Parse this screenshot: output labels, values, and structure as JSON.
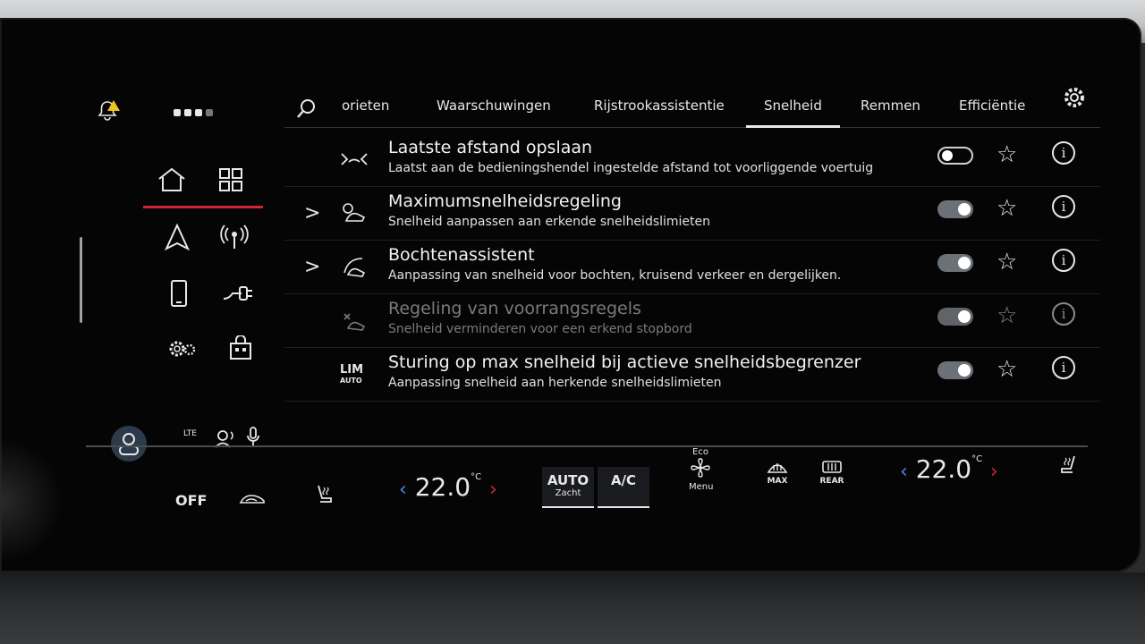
{
  "tabs": [
    "orieten",
    "Waarschuwingen",
    "Rijstrookassistentie",
    "Snelheid",
    "Remmen",
    "Efficiëntie"
  ],
  "active_tab": "Snelheid",
  "rows": [
    {
      "title": "Laatste afstand opslaan",
      "sub": "Laatst aan de bedieningshendel ingestelde afstand tot voorliggende voertuig",
      "toggle": "off",
      "chevron": "",
      "enabled": true
    },
    {
      "title": "Maximumsnelheidsregeling",
      "sub": "Snelheid aanpassen aan erkende snelheidslimieten",
      "toggle": "on",
      "chevron": ">",
      "enabled": true
    },
    {
      "title": "Bochtenassistent",
      "sub": "Aanpassing van snelheid voor bochten, kruisend verkeer en dergelijken.",
      "toggle": "on",
      "chevron": ">",
      "enabled": true
    },
    {
      "title": "Regeling van voorrangsregels",
      "sub": "Snelheid verminderen voor een erkend stopbord",
      "toggle": "on",
      "chevron": "",
      "enabled": false
    },
    {
      "title": "Sturing op max snelheid bij actieve snelheidsbegrenzer",
      "sub": "Aanpassing snelheid aan herkende snelheidslimieten",
      "toggle": "on",
      "chevron": "",
      "enabled": true
    }
  ],
  "lim_label": "LIM",
  "lim_sub": "AUTO",
  "left": {
    "lte": "LTE"
  },
  "climate": {
    "off_label": "OFF",
    "temp_left": "22.0",
    "temp_right": "22.0",
    "unit": "°C",
    "left_arrow": "‹",
    "right_arrow": "›",
    "auto_label": "AUTO",
    "auto_sub": "Zacht",
    "ac_label": "A/C",
    "eco_label": "Eco",
    "menu_label": "Menu",
    "max_label": "MAX",
    "rear_label": "REAR"
  }
}
